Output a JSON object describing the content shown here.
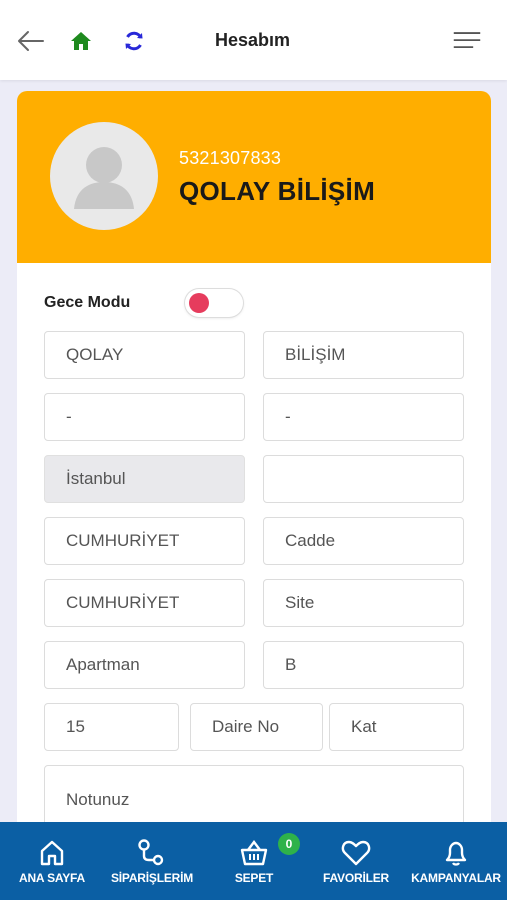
{
  "header": {
    "title": "Hesabım"
  },
  "profile": {
    "phone": "5321307833",
    "name": "QOLAY BİLİŞİM"
  },
  "settings": {
    "night_mode_label": "Gece Modu",
    "night_mode_on": false
  },
  "form": {
    "first_name": "QOLAY",
    "last_name": "BİLİŞİM",
    "field3": "-",
    "field4": "-",
    "city": "İstanbul",
    "district": "",
    "neighborhood": "CUMHURİYET",
    "street_placeholder": "Cadde",
    "avenue": "CUMHURİYET",
    "site_placeholder": "Site",
    "apartment_placeholder": "Apartman",
    "block": "B",
    "door_no": "15",
    "flat_placeholder": "Daire No",
    "floor_placeholder": "Kat",
    "note_placeholder": "Notunuz"
  },
  "bottom_nav": {
    "items": [
      {
        "label": "ANA SAYFA",
        "icon": "home-icon"
      },
      {
        "label": "SİPARİŞLERİM",
        "icon": "orders-icon"
      },
      {
        "label": "SEPET",
        "icon": "basket-icon",
        "badge": "0"
      },
      {
        "label": "FAVORİLER",
        "icon": "heart-icon"
      },
      {
        "label": "KAMPANYALAR",
        "icon": "bell-icon"
      }
    ]
  },
  "colors": {
    "accent": "#ffae00",
    "nav_bg": "#0b5fa4",
    "home_icon": "#1e8a1e",
    "refresh_icon": "#2828d8",
    "toggle_knob": "#e63c5d",
    "badge": "#2eb24a"
  }
}
